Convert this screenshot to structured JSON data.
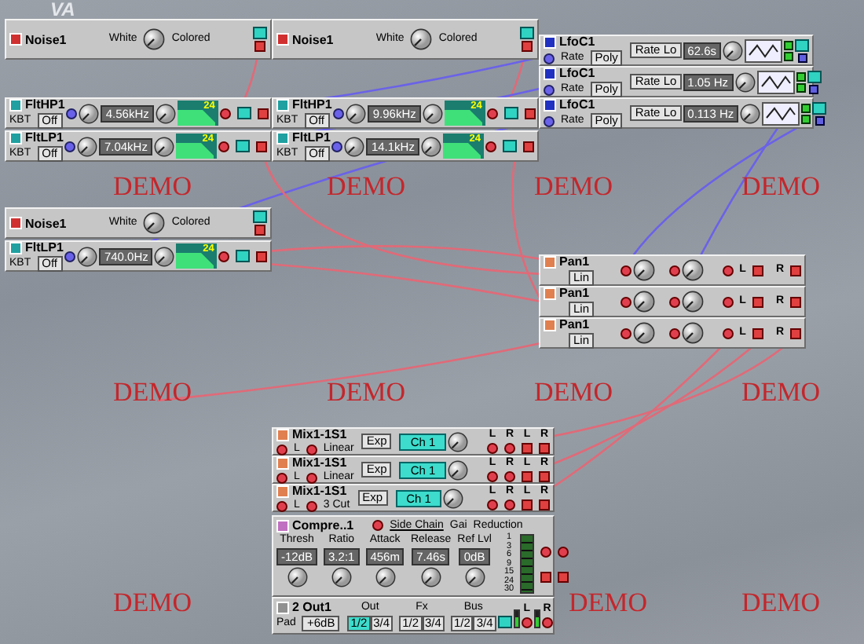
{
  "background_logo": "VA",
  "modules": [
    {
      "kind": "noise",
      "title": "Noise1",
      "left_label": "White",
      "right_label": "Colored"
    },
    {
      "kind": "noise",
      "title": "Noise1",
      "left_label": "White",
      "right_label": "Colored"
    },
    {
      "kind": "lfo",
      "title": "LfoC1",
      "rate_label": "Rate",
      "mode": "Poly",
      "range": "Rate Lo",
      "rate": "62.6s"
    },
    {
      "kind": "lfo",
      "title": "LfoC1",
      "rate_label": "Rate",
      "mode": "Poly",
      "range": "Rate Lo",
      "rate": "1.05 Hz"
    },
    {
      "kind": "filter",
      "title": "FltHP1",
      "kbt_label": "KBT",
      "kbt_value": "Off",
      "frequency": "4.56kHz",
      "slope": "24"
    },
    {
      "kind": "filter",
      "title": "FltHP1",
      "kbt_label": "KBT",
      "kbt_value": "Off",
      "frequency": "9.96kHz",
      "slope": "24"
    },
    {
      "kind": "lfo",
      "title": "LfoC1",
      "rate_label": "Rate",
      "mode": "Poly",
      "range": "Rate Lo",
      "rate": "0.113 Hz"
    },
    {
      "kind": "filter",
      "title": "FltLP1",
      "kbt_label": "KBT",
      "kbt_value": "Off",
      "frequency": "7.04kHz",
      "slope": "24"
    },
    {
      "kind": "filter",
      "title": "FltLP1",
      "kbt_label": "KBT",
      "kbt_value": "Off",
      "frequency": "14.1kHz",
      "slope": "24"
    },
    {
      "kind": "noise",
      "title": "Noise1",
      "left_label": "White",
      "right_label": "Colored"
    },
    {
      "kind": "filter",
      "title": "FltLP1",
      "kbt_label": "KBT",
      "kbt_value": "Off",
      "frequency": "740.0Hz",
      "slope": "24"
    },
    {
      "kind": "pan",
      "title": "Pan1",
      "curve": "Lin",
      "out_left": "L",
      "out_right": "R"
    },
    {
      "kind": "pan",
      "title": "Pan1",
      "curve": "Lin",
      "out_left": "L",
      "out_right": "R"
    },
    {
      "kind": "pan",
      "title": "Pan1",
      "curve": "Lin",
      "out_left": "L",
      "out_right": "R"
    },
    {
      "kind": "mixer",
      "title": "Mix1-1S1",
      "in_label": "L",
      "curve": "Linear",
      "exp": "Exp",
      "channel": "Ch 1",
      "outputs": [
        "L",
        "R",
        "L",
        "R"
      ]
    },
    {
      "kind": "mixer",
      "title": "Mix1-1S1",
      "in_label": "L",
      "curve": "Linear",
      "exp": "Exp",
      "channel": "Ch 1",
      "outputs": [
        "L",
        "R",
        "L",
        "R"
      ]
    },
    {
      "kind": "mixer",
      "title": "Mix1-1S1",
      "in_label": "L",
      "curve": "3 Cut",
      "exp": "Exp",
      "channel": "Ch 1",
      "outputs": [
        "L",
        "R",
        "L",
        "R"
      ]
    },
    {
      "kind": "compressor",
      "title": "Compre..1",
      "side_chain": "Side Chain",
      "gain_label": "Gai",
      "reduction_label": "Reduction",
      "params": [
        {
          "label": "Thresh",
          "value": "-12dB"
        },
        {
          "label": "Ratio",
          "value": "3.2:1"
        },
        {
          "label": "Attack",
          "value": "456m"
        },
        {
          "label": "Release",
          "value": "7.46s"
        },
        {
          "label": "Ref Lvl",
          "value": "0dB"
        }
      ],
      "meter_scale": [
        "1",
        "3",
        "6",
        "9",
        "15",
        "24",
        "30"
      ]
    },
    {
      "kind": "output",
      "title": "2 Out1",
      "pad_label": "Pad",
      "pad_value": "+6dB",
      "groups": [
        {
          "label": "Out",
          "buttons": [
            {
              "text": "1/2",
              "selected": true
            },
            {
              "text": "3/4",
              "selected": false
            }
          ]
        },
        {
          "label": "Fx",
          "buttons": [
            {
              "text": "1/2",
              "selected": false
            },
            {
              "text": "3/4",
              "selected": false
            }
          ]
        },
        {
          "label": "Bus",
          "buttons": [
            {
              "text": "1/2",
              "selected": false
            },
            {
              "text": "3/4",
              "selected": false
            }
          ]
        }
      ],
      "outputs": [
        "L",
        "R"
      ]
    }
  ],
  "demo_marks": [
    "DEMO",
    "DEMO",
    "DEMO",
    "DEMO",
    "DEMO",
    "DEMO",
    "DEMO",
    "DEMO",
    "DEMO",
    "DEMO",
    "DEMO"
  ]
}
